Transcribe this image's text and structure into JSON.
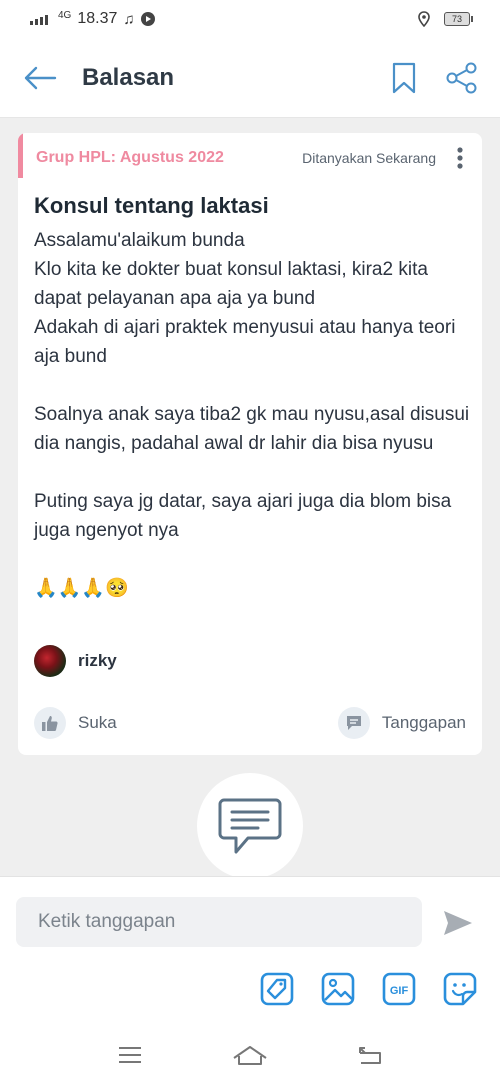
{
  "status_bar": {
    "signal": "4G",
    "time": "18.37",
    "battery": "73"
  },
  "header": {
    "title": "Balasan"
  },
  "post": {
    "group": "Grup HPL: Agustus 2022",
    "asked": "Ditanyakan Sekarang",
    "title": "Konsul tentang laktasi",
    "body": "Assalamu'alaikum bunda\nKlo kita ke dokter buat konsul laktasi, kira2 kita dapat pelayanan apa aja ya bund\nAdakah di ajari praktek menyusui atau hanya teori aja bund\n\nSoalnya anak saya tiba2 gk mau nyusu,asal disusui dia nangis, padahal awal dr lahir dia bisa nyusu\n\nPuting saya jg datar, saya ajari juga dia blom bisa juga ngenyot nya\n\n🙏🙏🙏🥺",
    "author": "rizky",
    "like_label": "Suka",
    "reply_label": "Tanggapan"
  },
  "reply_box": {
    "placeholder": "Ketik tanggapan",
    "gif_label": "GIF"
  },
  "colors": {
    "accent_pink": "#ef8aa0",
    "brand_blue": "#2a8fdc"
  }
}
